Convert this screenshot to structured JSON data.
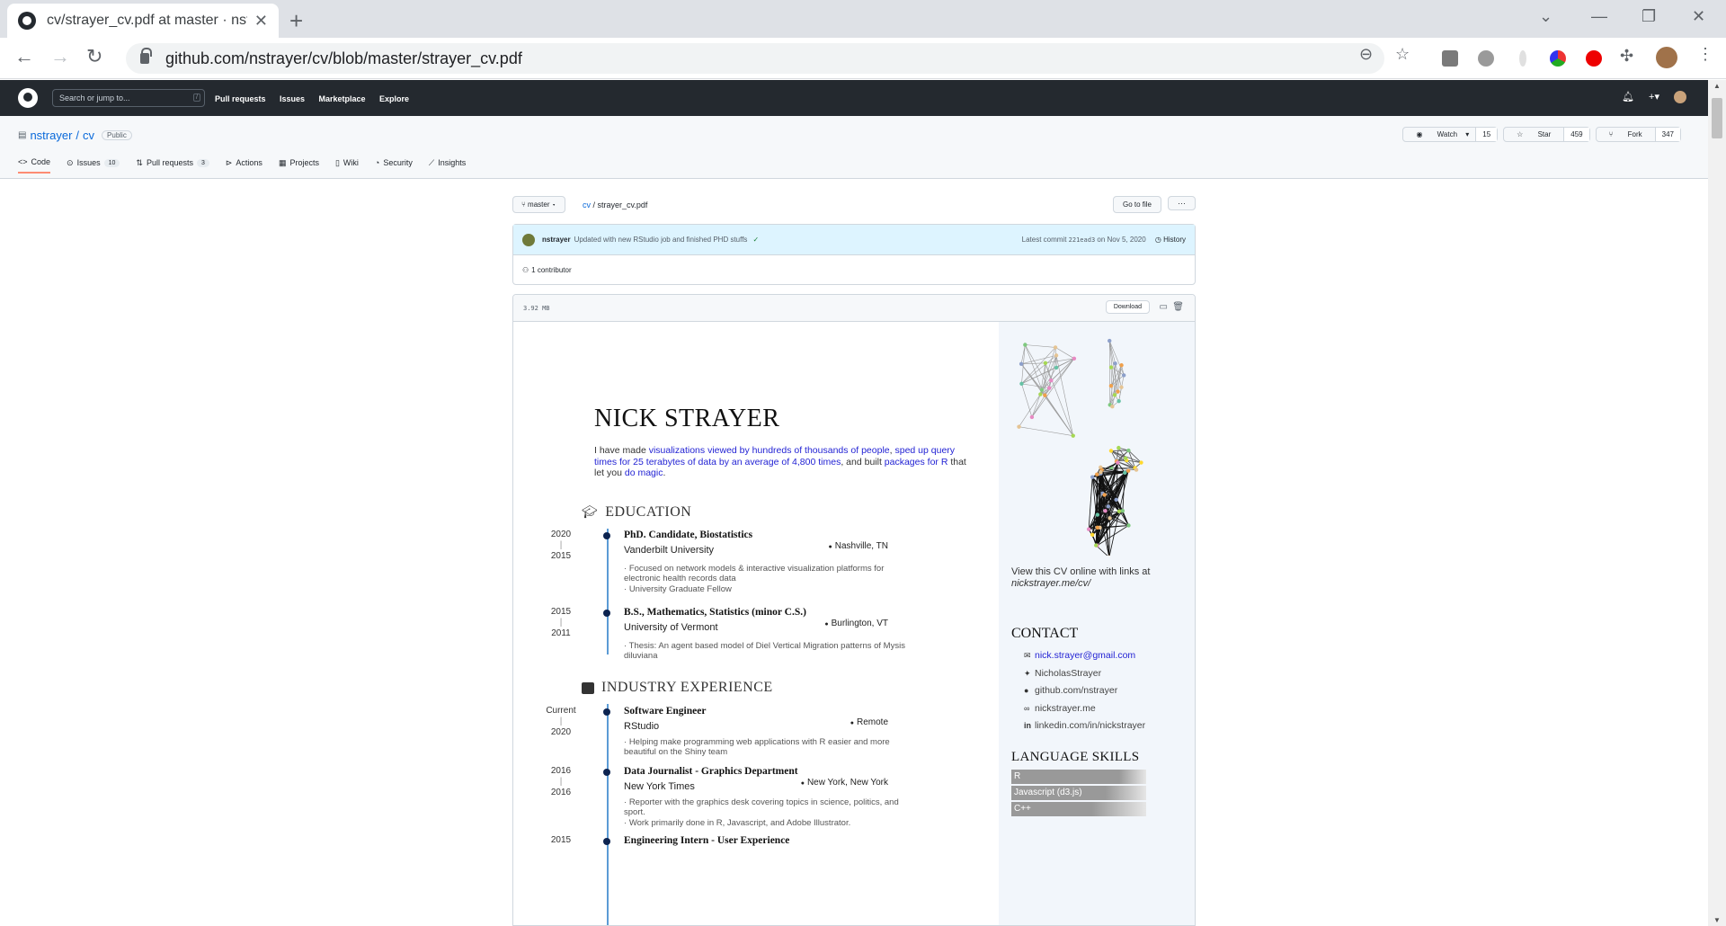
{
  "browser": {
    "tab_title": "cv/strayer_cv.pdf at master · nstra",
    "url": "github.com/nstrayer/cv/blob/master/strayer_cv.pdf"
  },
  "github": {
    "search_placeholder": "Search or jump to...",
    "search_key": "/",
    "nav": [
      "Pull requests",
      "Issues",
      "Marketplace",
      "Explore"
    ]
  },
  "repo": {
    "owner": "nstrayer",
    "name": "cv",
    "visibility": "Public",
    "watch_label": "Watch",
    "watch_count": "15",
    "star_label": "Star",
    "star_count": "459",
    "fork_label": "Fork",
    "fork_count": "347",
    "tabs": [
      {
        "label": "Code",
        "count": ""
      },
      {
        "label": "Issues",
        "count": "10"
      },
      {
        "label": "Pull requests",
        "count": "3"
      },
      {
        "label": "Actions",
        "count": ""
      },
      {
        "label": "Projects",
        "count": ""
      },
      {
        "label": "Wiki",
        "count": ""
      },
      {
        "label": "Security",
        "count": ""
      },
      {
        "label": "Insights",
        "count": ""
      }
    ]
  },
  "file": {
    "branch": "master",
    "crumb_repo": "cv",
    "crumb_file": "strayer_cv.pdf",
    "goto_label": "Go to file",
    "more_label": "···",
    "commit_author": "nstrayer",
    "commit_message": "Updated with new RStudio job and finished PHD stuffs",
    "latest_commit_label": "Latest commit",
    "commit_sha": "221ead3",
    "commit_date": "on Nov 5, 2020",
    "history_label": "History",
    "contributors": "1 contributor",
    "size": "3.92 MB",
    "download_label": "Download"
  },
  "cv": {
    "name": "NICK STRAYER",
    "intro_pre": "I have made ",
    "intro_link1": "visualizations viewed by hundreds of thousands of people",
    "intro_sep1": ", ",
    "intro_link2": "sped up query times for 25 terabytes of data by an average of 4,800 times",
    "intro_mid": ", and built ",
    "intro_link3": "packages for R",
    "intro_mid2": " that let you ",
    "intro_link4": "do magic",
    "intro_end": ".",
    "education_title": "EDUCATION",
    "education": [
      {
        "end": "2020",
        "start": "2015",
        "title": "PhD. Candidate, Biostatistics",
        "org": "Vanderbilt University",
        "location": "Nashville, TN",
        "bullets": [
          "Focused on network models & interactive visualization platforms for electronic health records data",
          "University Graduate Fellow"
        ]
      },
      {
        "end": "2015",
        "start": "2011",
        "title": "B.S., Mathematics, Statistics (minor C.S.)",
        "org": "University of Vermont",
        "location": "Burlington, VT",
        "bullets": [
          "Thesis: An agent based model of Diel Vertical Migration patterns of Mysis diluviana"
        ]
      }
    ],
    "industry_title": "INDUSTRY EXPERIENCE",
    "industry": [
      {
        "end": "Current",
        "start": "2020",
        "title": "Software Engineer",
        "org": "RStudio",
        "location": "Remote",
        "bullets": [
          "Helping make programming web applications with R easier and more beautiful on the Shiny team"
        ]
      },
      {
        "end": "2016",
        "start": "2016",
        "title": "Data Journalist - Graphics Department",
        "org": "New York Times",
        "location": "New York, New York",
        "bullets": [
          "Reporter with the graphics desk covering topics in science, politics, and sport.",
          "Work primarily done in R, Javascript, and Adobe Illustrator."
        ]
      },
      {
        "end": "2015",
        "start": "",
        "title": "Engineering Intern - User Experience",
        "org": "",
        "location": "",
        "bullets": []
      }
    ],
    "online_text": "View this CV online with links at",
    "online_link": "nickstrayer.me/cv/",
    "contact_title": "CONTACT",
    "contacts": [
      "nick.strayer@gmail.com",
      "NicholasStrayer",
      "github.com/nstrayer",
      "nickstrayer.me",
      "linkedin.com/in/nickstrayer"
    ],
    "language_title": "LANGUAGE SKILLS",
    "skills": [
      "R",
      "Javascript (d3.js)",
      "C++"
    ]
  }
}
